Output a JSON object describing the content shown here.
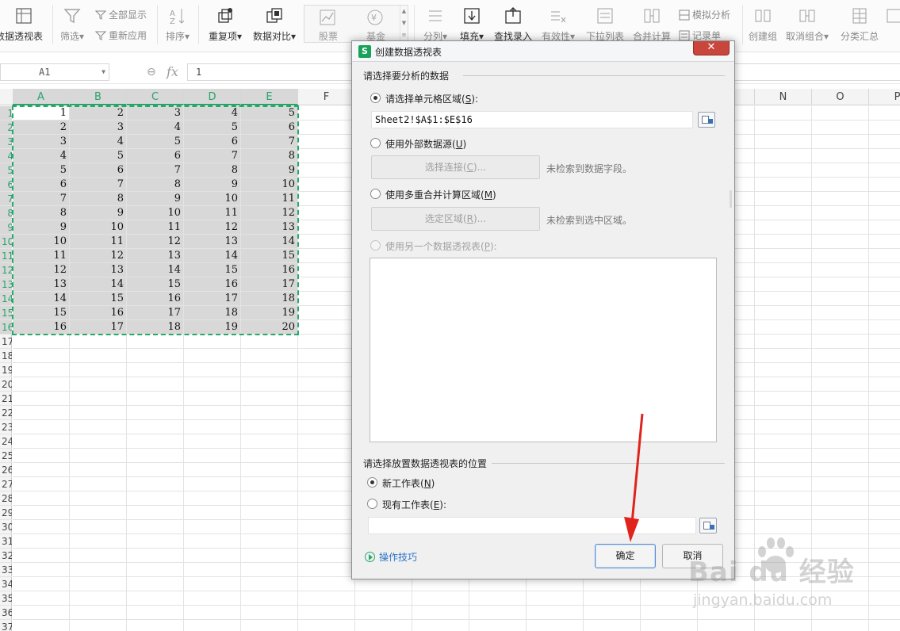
{
  "ribbon": {
    "pivot_label": "数据透视表",
    "filter_label": "筛选",
    "show_all_label": "全部显示",
    "reapply_label": "重新应用",
    "sort_label": "排序",
    "duplicates_label": "重复项",
    "compare_label": "数据对比",
    "gallery": [
      "股票",
      "基金"
    ],
    "split_label": "分列",
    "fill_label": "填充",
    "lookup_label": "查找录入",
    "validity_label": "有效性",
    "dropdown_label": "下拉列表",
    "consolidate_label": "合并计算",
    "whatif_label": "模拟分析",
    "record_label": "记录单",
    "group_label": "创建组",
    "ungroup_label": "取消组合",
    "subtotal_label": "分类汇总"
  },
  "formula_bar": {
    "name_box": "A1",
    "fx": "fx",
    "value": "1"
  },
  "sheet": {
    "columns": [
      "A",
      "B",
      "C",
      "D",
      "E",
      "F",
      "N",
      "O",
      "P"
    ],
    "row_numbers": [
      "1",
      "2",
      "3",
      "4",
      "5",
      "6",
      "7",
      "8",
      "9",
      "10",
      "11",
      "12",
      "13",
      "14",
      "15",
      "16",
      "17",
      "18",
      "19",
      "20",
      "21",
      "22",
      "23",
      "24",
      "25",
      "26",
      "27",
      "28",
      "29",
      "30",
      "31",
      "32",
      "33",
      "34",
      "35",
      "36",
      "37"
    ],
    "data": [
      [
        1,
        2,
        3,
        4,
        5
      ],
      [
        2,
        3,
        4,
        5,
        6
      ],
      [
        3,
        4,
        5,
        6,
        7
      ],
      [
        4,
        5,
        6,
        7,
        8
      ],
      [
        5,
        6,
        7,
        8,
        9
      ],
      [
        6,
        7,
        8,
        9,
        10
      ],
      [
        7,
        8,
        9,
        10,
        11
      ],
      [
        8,
        9,
        10,
        11,
        12
      ],
      [
        9,
        10,
        11,
        12,
        13
      ],
      [
        10,
        11,
        12,
        13,
        14
      ],
      [
        11,
        12,
        13,
        14,
        15
      ],
      [
        12,
        13,
        14,
        15,
        16
      ],
      [
        13,
        14,
        15,
        16,
        17
      ],
      [
        14,
        15,
        16,
        17,
        18
      ],
      [
        15,
        16,
        17,
        18,
        19
      ],
      [
        16,
        17,
        18,
        19,
        20
      ]
    ]
  },
  "dialog": {
    "logo": "S",
    "title": "创建数据透视表",
    "close": "✕",
    "section1": "请选择要分析的数据",
    "opt_range": {
      "text": "请选择单元格区域(",
      "key": "S",
      "end": "):"
    },
    "range_value": "Sheet2!$A$1:$E$16",
    "opt_external": {
      "text": "使用外部数据源(",
      "key": "U",
      "end": ")"
    },
    "btn_connect": {
      "text": "选择连接(",
      "key": "C",
      "end": ")..."
    },
    "hint_connect": "未检索到数据字段。",
    "opt_multi": {
      "text": "使用多重合并计算区域(",
      "key": "M",
      "end": ")"
    },
    "btn_region": {
      "text": "选定区域(",
      "key": "R",
      "end": ")..."
    },
    "hint_region": "未检索到选中区域。",
    "opt_other": {
      "text": "使用另一个数据透视表(",
      "key": "P",
      "end": "):"
    },
    "section2": "请选择放置数据透视表的位置",
    "opt_new": {
      "text": "新工作表(",
      "key": "N",
      "end": ")"
    },
    "opt_existing": {
      "text": "现有工作表(",
      "key": "E",
      "end": "):"
    },
    "existing_value": "",
    "tips": "操作技巧",
    "ok": "确定",
    "cancel": "取消"
  },
  "watermark": {
    "brand": "Bai du 经验",
    "url": "jingyan.baidu.com"
  },
  "colors": {
    "accent_green": "#27a86e",
    "selection_gray": "#d8d8d8",
    "close_red": "#c8463b",
    "arrow_red": "#e0241b",
    "link_blue": "#2f75c9"
  },
  "icons": [
    "pivot-icon",
    "filter-icon",
    "show-all-icon",
    "reapply-icon",
    "sort-icon",
    "duplicates-icon",
    "compare-icon",
    "split-icon",
    "fill-icon",
    "lookup-icon",
    "validity-icon",
    "dropdown-icon",
    "consolidate-icon",
    "whatif-icon",
    "record-icon",
    "group-icon",
    "ungroup-icon",
    "subtotal-icon",
    "zoom-icon",
    "fx-icon",
    "range-picker-icon",
    "play-icon",
    "paw-icon"
  ]
}
